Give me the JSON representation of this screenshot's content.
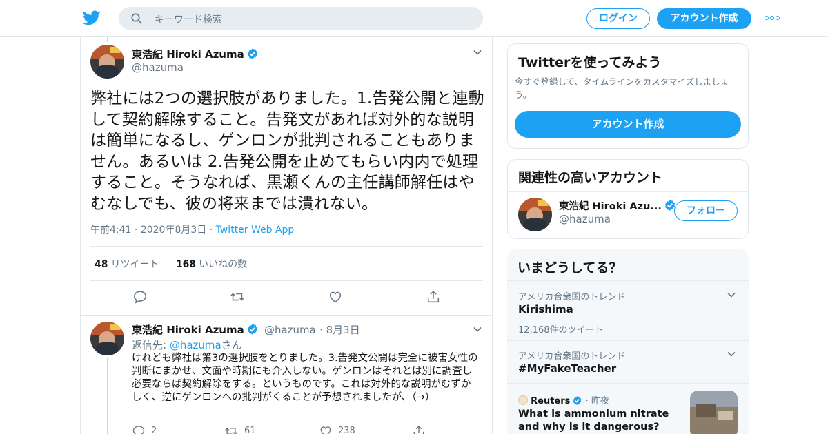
{
  "colors": {
    "accent": "#1da1f2",
    "text": "#14171a",
    "muted": "#657786",
    "border": "#e1e8ed"
  },
  "header": {
    "logo_icon": "twitter-bird-icon",
    "search_placeholder": "キーワード検索",
    "login_label": "ログイン",
    "signup_label": "アカウント作成",
    "more_icon": "more-dots-icon"
  },
  "main_tweet": {
    "author_name": "東浩紀 Hiroki Azuma",
    "handle": "@hazuma",
    "text": "弊社には2つの選択肢がありました。1.告発公開と連動して契約解除すること。告発文があれば対外的な説明は簡単になるし、ゲンロンが批判されることもありません。あるいは 2.告発公開を止めてもらい内内で処理すること。そうなれば、黒瀬くんの主任講師解任はやむなしでも、彼の将来までは潰れない。",
    "time": "午前4:41",
    "date": "2020年8月3日",
    "via": "Twitter Web App",
    "retweet_count": "48",
    "retweet_label": "リツイート",
    "like_count": "168",
    "like_label": "いいねの数"
  },
  "reply_tweet": {
    "author_name": "東浩紀 Hiroki Azuma",
    "handle": "@hazuma",
    "date": "8月3日",
    "replying_prefix": "返信先: ",
    "replying_handle": "@hazuma",
    "replying_suffix": "さん",
    "text": "けれども弊社は第3の選択肢をとりました。3.告発文公開は完全に被害女性の判断にまかせ、文面や時期にも介入しない。ゲンロンはそれとは別に調査し必要ならば契約解除をする。というものです。これは対外的な説明がむずかしく、逆にゲンロンへの批判がくることが予想されましたが、（→）",
    "reply_count": "2",
    "retweet_count": "61",
    "like_count": "238"
  },
  "signup_card": {
    "title": "Twitterを使ってみよう",
    "subtitle": "今すぐ登録して、タイムラインをカスタマイズしましょう。",
    "button_label": "アカウント作成"
  },
  "related_card": {
    "title": "関連性の高いアカウント",
    "account_name": "東浩紀 Hiroki Azu...",
    "account_handle": "@hazuma",
    "follow_label": "フォロー"
  },
  "trends_card": {
    "title": "いまどうしてる？",
    "trends": [
      {
        "context": "アメリカ合衆国のトレンド",
        "name": "Kirishima",
        "count": "12,168件のツイート"
      },
      {
        "context": "アメリカ合衆国のトレンド",
        "name": "#MyFakeTeacher"
      }
    ],
    "news": {
      "source": "Reuters",
      "time": "昨夜",
      "headline": "What is ammonium nitrate and why is it dangerous?"
    }
  }
}
